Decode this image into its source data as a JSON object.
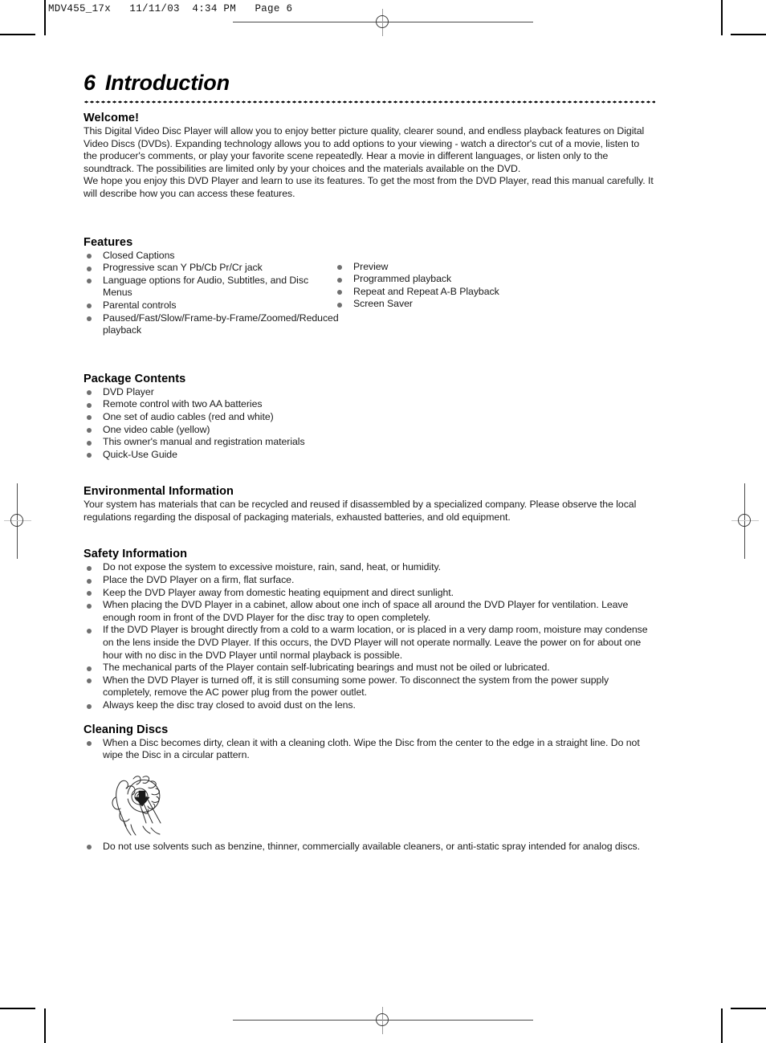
{
  "page_header": "MDV455_17x   11/11/03  4:34 PM   Page 6",
  "chapter": {
    "number": "6",
    "title": "Introduction"
  },
  "sections": {
    "welcome": {
      "heading": "Welcome!",
      "paragraph1": "This Digital Video Disc Player will allow you to enjoy better picture quality, clearer sound, and endless playback features on Digital Video Discs (DVDs). Expanding technology allows you to add options to your viewing - watch a director's cut of a movie, listen to the producer's comments, or play your favorite scene repeatedly. Hear a movie in different languages, or listen only to the soundtrack. The possibilities are limited only by your choices and the materials available on the DVD.",
      "paragraph2": "We hope you enjoy this DVD Player and learn to use its features. To get the most from the DVD Player, read this manual carefully. It will describe how you can access these features."
    },
    "features": {
      "heading": "Features",
      "column_left": [
        "Closed Captions",
        "Progressive scan Y Pb/Cb Pr/Cr jack",
        "Language options for Audio, Subtitles, and Disc Menus",
        "Parental controls",
        "Paused/Fast/Slow/Frame-by-Frame/Zoomed/Reduced playback"
      ],
      "column_right": [
        "Preview",
        "Programmed playback",
        "Repeat and Repeat A-B Playback",
        "Screen Saver"
      ]
    },
    "package_contents": {
      "heading": "Package Contents",
      "items": [
        "DVD Player",
        "Remote control with two AA batteries",
        "One set of audio cables (red and white)",
        "One video cable (yellow)",
        "This owner's manual and registration materials",
        "Quick-Use Guide"
      ]
    },
    "environmental_information": {
      "heading": "Environmental Information",
      "paragraph": "Your system has materials that can be recycled and reused if disassembled by a specialized company. Please observe the local regulations regarding the disposal of packaging materials, exhausted batteries, and old equipment."
    },
    "safety_information": {
      "heading": "Safety Information",
      "items": [
        "Do not expose the system to excessive moisture, rain, sand, heat, or humidity.",
        "Place the DVD Player on a firm, flat surface.",
        "Keep the DVD Player away from domestic heating equipment and direct sunlight.",
        "When placing the DVD Player in a cabinet, allow about one inch of space all around the DVD Player for ventilation. Leave enough room in front of the DVD Player for the disc tray to open completely.",
        "If the DVD Player is brought directly from a cold to a warm location, or is placed in a very damp room, moisture may condense on the lens inside the DVD Player. If this occurs, the DVD Player will not operate normally. Leave the power on for about one hour with no disc in the DVD Player until normal playback is possible.",
        "The mechanical parts of the Player contain self-lubricating bearings and must not be oiled or lubricated.",
        "When the DVD Player is turned off, it is still consuming some power. To disconnect the system from the power supply completely, remove the AC power plug from the power outlet.",
        "Always keep the disc tray closed to avoid dust on the lens."
      ]
    },
    "cleaning_discs": {
      "heading": "Cleaning Discs",
      "item_before_figure": "When a Disc becomes dirty, clean it with a cleaning cloth. Wipe the Disc from the center to the edge in a straight line. Do not wipe the Disc in a circular pattern.",
      "figure_caption": "hand-wiping-disc-illustration",
      "item_after_figure": "Do not use solvents such as benzine, thinner, commercially available cleaners, or anti-static spray intended for analog discs."
    }
  },
  "colors": {
    "text": "#1a1a1a",
    "bullet": "#6f6f6f",
    "rule": "#141414",
    "registration_mark": "#4a4a4a"
  }
}
